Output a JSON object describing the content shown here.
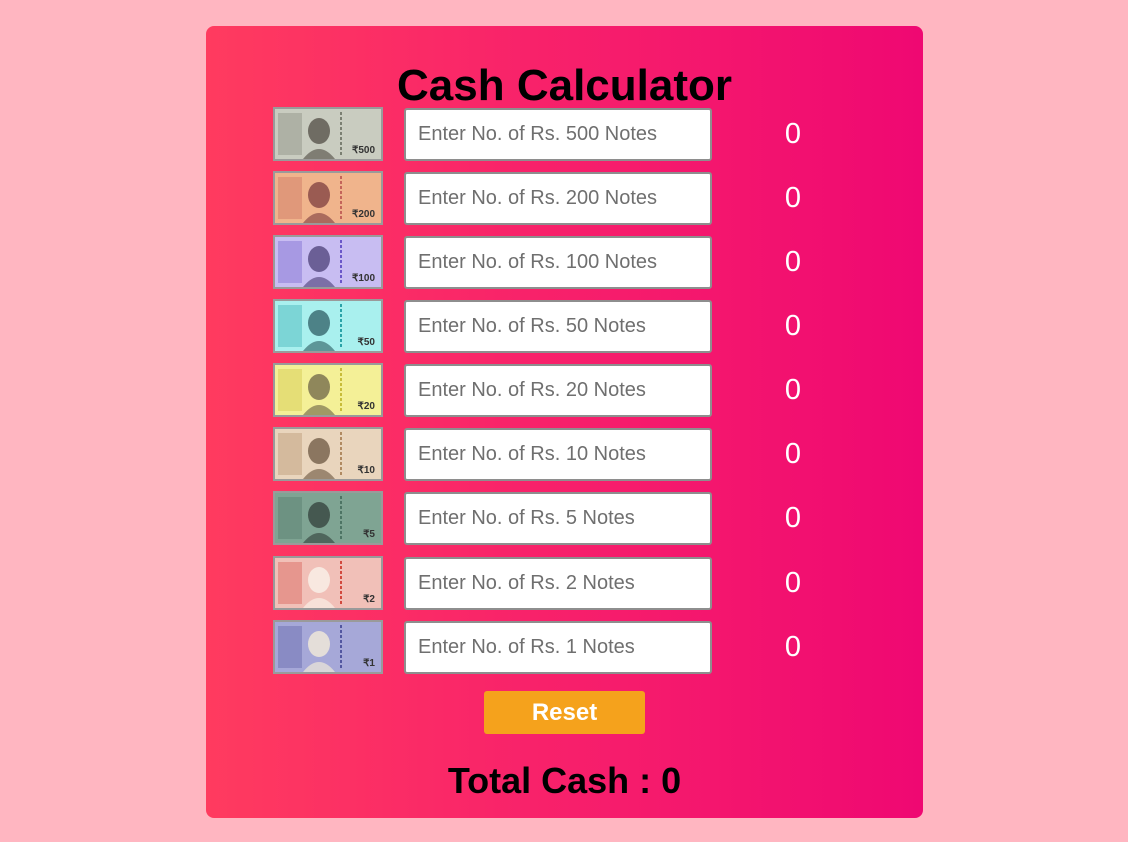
{
  "app": {
    "title": "Cash Calculator"
  },
  "denominations": [
    {
      "label": "₹500",
      "numeral": "500",
      "placeholder": "Enter No. of Rs. 500 Notes",
      "value": "",
      "amount": "0",
      "bg": "#c9ccc0",
      "accent": "#7a7f72",
      "face": "#5f5b52"
    },
    {
      "label": "₹200",
      "numeral": "200",
      "placeholder": "Enter No. of Rs. 200 Notes",
      "value": "",
      "amount": "0",
      "bg": "#f0b48c",
      "accent": "#c4645a",
      "face": "#8b4b48"
    },
    {
      "label": "₹100",
      "numeral": "100",
      "placeholder": "Enter No. of Rs. 100 Notes",
      "value": "",
      "amount": "0",
      "bg": "#c8bdf2",
      "accent": "#6b57c9",
      "face": "#5b4f86"
    },
    {
      "label": "₹50",
      "numeral": "50",
      "placeholder": "Enter No. of Rs. 50 Notes",
      "value": "",
      "amount": "0",
      "bg": "#a9f0ee",
      "accent": "#29a3a8",
      "face": "#3d6f74"
    },
    {
      "label": "₹20",
      "numeral": "20",
      "placeholder": "Enter No. of Rs. 20 Notes",
      "value": "",
      "amount": "0",
      "bg": "#f4f097",
      "accent": "#c8bc3a",
      "face": "#7c7450"
    },
    {
      "label": "₹10",
      "numeral": "10",
      "placeholder": "Enter No. of Rs. 10 Notes",
      "value": "",
      "amount": "0",
      "bg": "#e9d5bd",
      "accent": "#b08a62",
      "face": "#7a6550"
    },
    {
      "label": "₹5",
      "numeral": "5",
      "placeholder": "Enter No. of Rs. 5 Notes",
      "value": "",
      "amount": "0",
      "bg": "#7fa493",
      "accent": "#4d7464",
      "face": "#3b4b44"
    },
    {
      "label": "₹2",
      "numeral": "2",
      "placeholder": "Enter No. of Rs. 2 Notes",
      "value": "",
      "amount": "0",
      "bg": "#f1c0b8",
      "accent": "#d2493e",
      "face": "#f9efe6"
    },
    {
      "label": "₹1",
      "numeral": "1",
      "placeholder": "Enter No. of Rs. 1 Notes",
      "value": "",
      "amount": "0",
      "bg": "#a6a8d8",
      "accent": "#5256a0",
      "face": "#efe8d9"
    }
  ],
  "actions": {
    "reset_label": "Reset"
  },
  "total": {
    "label": "Total Cash : 0"
  },
  "colors": {
    "page_bg": "#ffb6c1",
    "card_gradient_start": "#ff3b5f",
    "card_gradient_end": "#ef0872",
    "reset_button": "#f5a21c"
  }
}
